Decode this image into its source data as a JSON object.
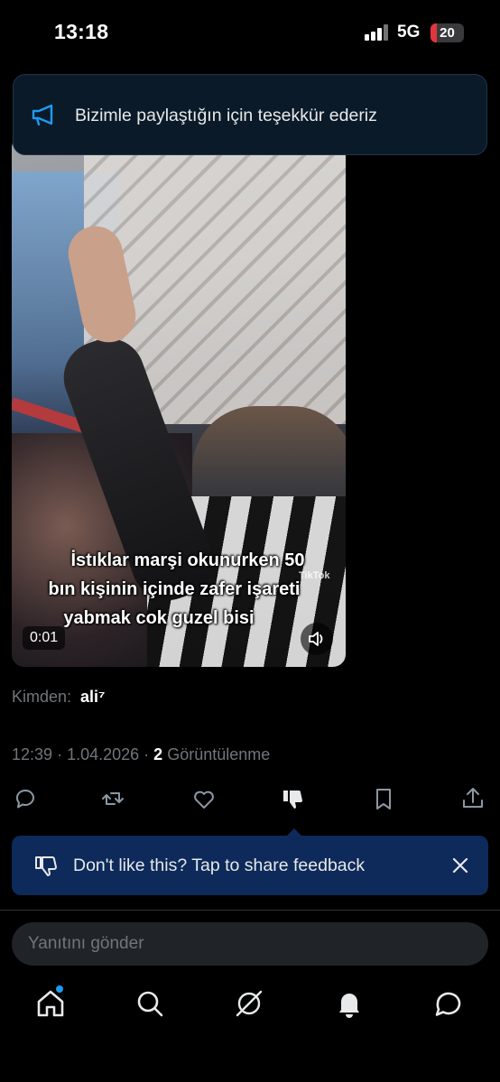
{
  "status_bar": {
    "time": "13:18",
    "network": "5G",
    "battery_level": "20"
  },
  "toast": {
    "icon": "megaphone-icon",
    "text": "Bizimle paylaştığın için teşekkür ederiz"
  },
  "video": {
    "caption_lines": [
      "İstıklar marşi okunurken 50",
      "bın kişinin içinde zafer işareti",
      "yabmak cok guzel bisi"
    ],
    "duration": "0:01",
    "watermark": "TikTok"
  },
  "post": {
    "from_label": "Kimden:",
    "from_name": "ali⁷",
    "time": "12:39",
    "date": "1.04.2026",
    "views_count": "2",
    "views_label": "Görüntülenme"
  },
  "actions": [
    "reply-icon",
    "repost-icon",
    "like-icon",
    "dislike-icon",
    "bookmark-icon",
    "share-icon"
  ],
  "feedback": {
    "icon": "dislike-icon",
    "text": "Don't like this? Tap to share feedback"
  },
  "reply": {
    "placeholder": "Yanıtını gönder"
  },
  "bottom_nav": [
    "home-icon",
    "search-icon",
    "grok-icon",
    "notifications-icon",
    "messages-icon"
  ],
  "colors": {
    "accent": "#1d9bf0",
    "feedback_bg": "#0d2a5a",
    "battery_red": "#e0373d",
    "muted_text": "#71767b"
  }
}
